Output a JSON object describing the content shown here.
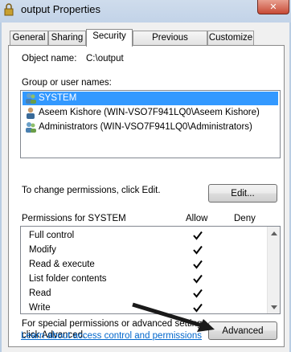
{
  "window": {
    "title": "output Properties",
    "close_glyph": "✕"
  },
  "tabs": [
    {
      "label": "General"
    },
    {
      "label": "Sharing"
    },
    {
      "label": "Security",
      "active": true
    },
    {
      "label": "Previous Versions"
    },
    {
      "label": "Customize"
    }
  ],
  "security": {
    "object_name_label": "Object name:",
    "object_name_value": "C:\\output",
    "group_label": "Group or user names:",
    "users": [
      {
        "name": "SYSTEM",
        "selected": true
      },
      {
        "name": "Aseem Kishore (WIN-VSO7F941LQ0\\Aseem Kishore)",
        "selected": false
      },
      {
        "name": "Administrators (WIN-VSO7F941LQ0\\Administrators)",
        "selected": false
      }
    ],
    "change_text": "To change permissions, click Edit.",
    "edit_label": "Edit...",
    "permissions_label": "Permissions for SYSTEM",
    "allow_header": "Allow",
    "deny_header": "Deny",
    "permissions": [
      {
        "name": "Full control",
        "allow": true,
        "deny": false
      },
      {
        "name": "Modify",
        "allow": true,
        "deny": false
      },
      {
        "name": "Read & execute",
        "allow": true,
        "deny": false
      },
      {
        "name": "List folder contents",
        "allow": true,
        "deny": false
      },
      {
        "name": "Read",
        "allow": true,
        "deny": false
      },
      {
        "name": "Write",
        "allow": true,
        "deny": false
      }
    ],
    "special_text_line1": "For special permissions or advanced settings,",
    "special_text_line2": "click Advanced.",
    "advanced_label": "Advanced",
    "learn_link": "Learn about access control and permissions"
  },
  "colors": {
    "selection": "#3399ff",
    "link": "#0066cc",
    "arrow": "#1a1a1a"
  }
}
